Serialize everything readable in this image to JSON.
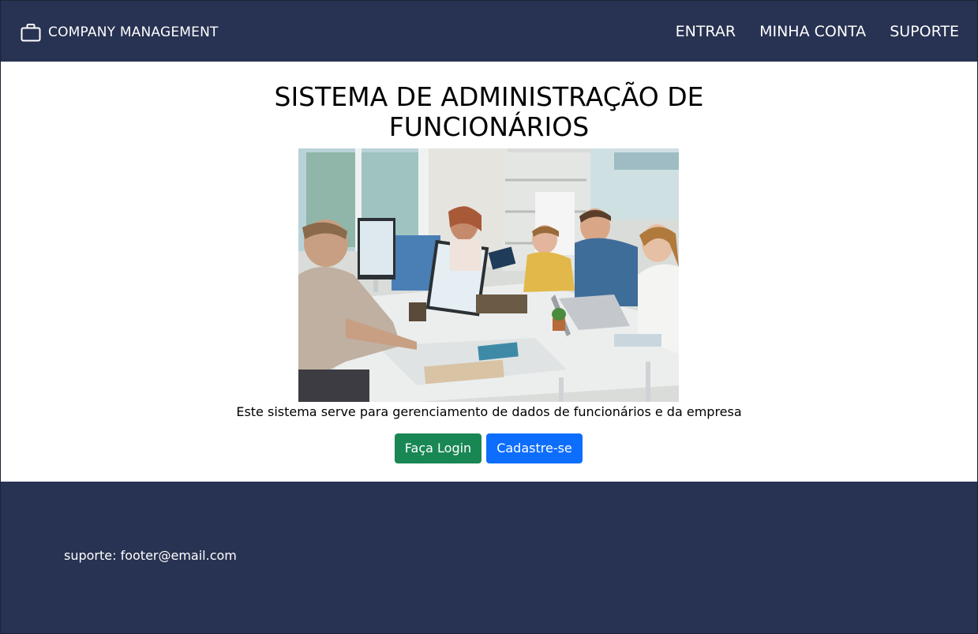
{
  "navbar": {
    "brand": "COMPANY MANAGEMENT",
    "brand_icon": "briefcase-icon",
    "links": [
      {
        "label": "ENTRAR"
      },
      {
        "label": "MINHA CONTA"
      },
      {
        "label": "SUPORTE"
      }
    ],
    "background": "#283252"
  },
  "main": {
    "title_line1": "SISTEMA DE ADMINISTRAÇÃO DE",
    "title_line2": "FUNCIONÁRIOS",
    "hero_image": "office-team-photo",
    "description": "Este sistema serve para gerenciamento de dados de funcionários e da empresa",
    "login_label": "Faça Login",
    "signup_label": "Cadastre-se",
    "login_color": "#198754",
    "signup_color": "#0d6efd"
  },
  "footer": {
    "text": "suporte: footer@email.com",
    "background": "#283252"
  }
}
